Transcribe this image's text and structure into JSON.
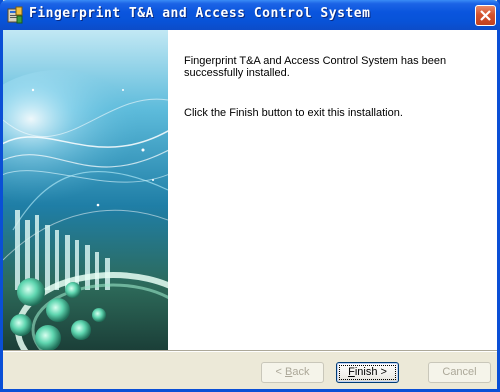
{
  "window": {
    "title": "Fingerprint T&A and Access Control System",
    "icons": {
      "app": "installer-icon",
      "close": "close-icon"
    }
  },
  "message": {
    "line1": "Fingerprint T&A and Access Control System has been successfully installed.",
    "line2": "Click the Finish button to exit this installation."
  },
  "buttons": {
    "back": {
      "pre": "< ",
      "accel": "B",
      "rest": "ack",
      "enabled": false
    },
    "finish": {
      "accel": "F",
      "rest": "inish >",
      "enabled": true,
      "default": true
    },
    "cancel": {
      "label": "Cancel",
      "enabled": false
    }
  },
  "colors": {
    "titlebar": "#0a55de",
    "close_button": "#d4532e",
    "dialog_bg": "#ece9d8",
    "panel_bg": "#ffffff"
  }
}
